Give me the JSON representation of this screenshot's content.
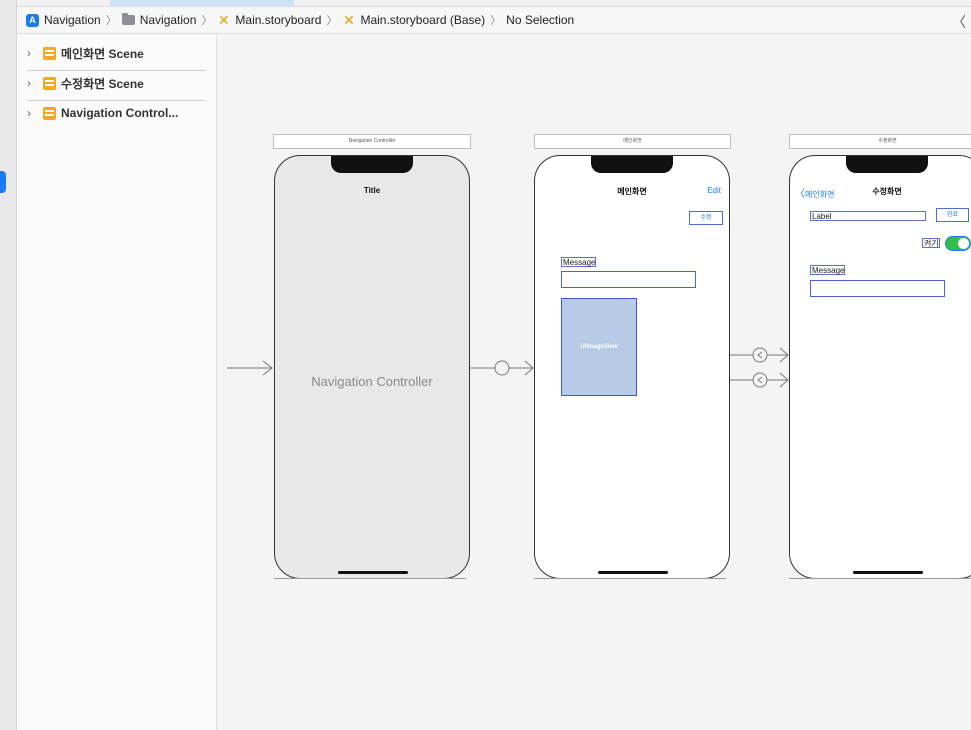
{
  "breadcrumb": {
    "items": [
      "Navigation",
      "Navigation",
      "Main.storyboard",
      "Main.storyboard (Base)",
      "No Selection"
    ],
    "back_glyph": "〈"
  },
  "outline": {
    "items": [
      {
        "label": "메인화면 Scene",
        "icon": "scene-icon"
      },
      {
        "label": "수정화면 Scene",
        "icon": "scene-icon"
      },
      {
        "label": "Navigation Control...",
        "icon": "navigation-controller-icon"
      }
    ]
  },
  "scenes": {
    "nav_controller": {
      "header": "Navigation Controller",
      "nav_title": "Title",
      "body_label": "Navigation Controller"
    },
    "main": {
      "header": "메인화면",
      "nav_title": "메인화면",
      "edit_label": "Edit",
      "edit_button": "수정",
      "message_label": "Message",
      "image_view_label": "UIImageView"
    },
    "edit": {
      "header": "수정화면",
      "back_label": "메인화면",
      "nav_title": "수정화면",
      "label_text": "Label",
      "done_button": "완료",
      "toggle_label": "켜기",
      "message_label": "Message"
    }
  },
  "colors": {
    "accent": "#1a7cf5",
    "toggle_on": "#2fbf4a",
    "image_view_fill": "#b8cbe6",
    "scene_icon": "#f5a623"
  }
}
